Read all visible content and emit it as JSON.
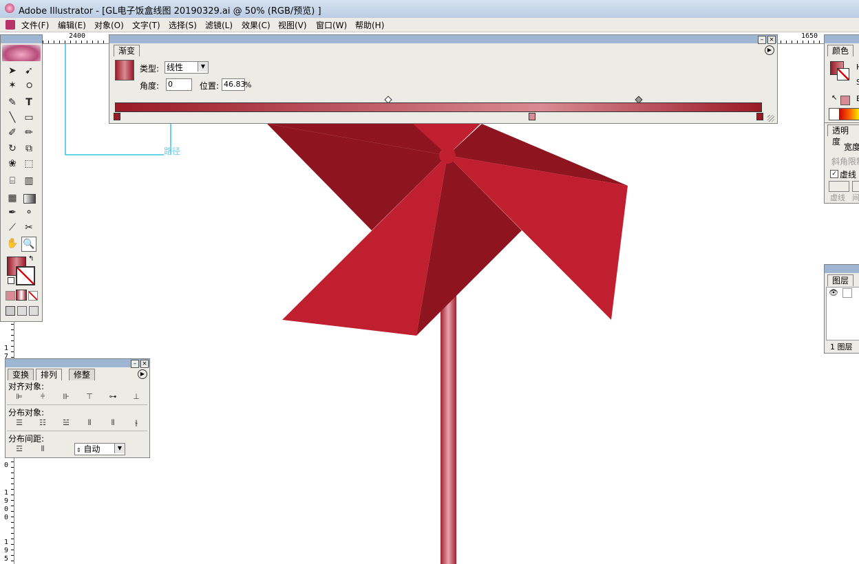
{
  "window": {
    "title": "Adobe Illustrator - [GL电子饭盒线图 20190329.ai @ 50% (RGB/预览) ]"
  },
  "menu": [
    "文件(F)",
    "编辑(E)",
    "对象(O)",
    "文字(T)",
    "选择(S)",
    "滤镜(L)",
    "效果(C)",
    "视图(V)",
    "窗口(W)",
    "帮助(H)"
  ],
  "ruler": {
    "h_left": "2400",
    "h_right": "1650",
    "v_labels": [
      "1",
      "7",
      "0",
      "1",
      "9",
      "0",
      "0",
      "1",
      "9",
      "5"
    ]
  },
  "canvas": {
    "path_label": "路径"
  },
  "gradient_panel": {
    "tab": "渐变",
    "type_label": "类型:",
    "type_value": "线性",
    "angle_label": "角度:",
    "angle_value": "0",
    "position_label": "位置:",
    "position_value": "46.83",
    "percent": "%",
    "colors": {
      "dark": "#9a1a26",
      "light": "#d98a94"
    }
  },
  "align_panel": {
    "tabs": [
      "变换",
      "排列",
      "修整"
    ],
    "align_objects_label": "对齐对象:",
    "distribute_objects_label": "分布对象:",
    "distribute_spacing_label": "分布间距:",
    "spacing_value": "自动"
  },
  "color_panel": {
    "tab": "颜色",
    "h_label": "H",
    "s_label": "S",
    "b_label": "B"
  },
  "stroke_panel": {
    "tab": "透明度",
    "width_label": "宽度",
    "miter_label": "斜角限制",
    "dashed_label": "虚线",
    "dash_label": "虚线",
    "gap_label": "间"
  },
  "layers_panel": {
    "tab": "图层",
    "count_label": "1 图层"
  },
  "colors": {
    "pinwheel_red": "#c01f2f",
    "pinwheel_dark": "#8e1520",
    "stick": "#d1707e"
  }
}
